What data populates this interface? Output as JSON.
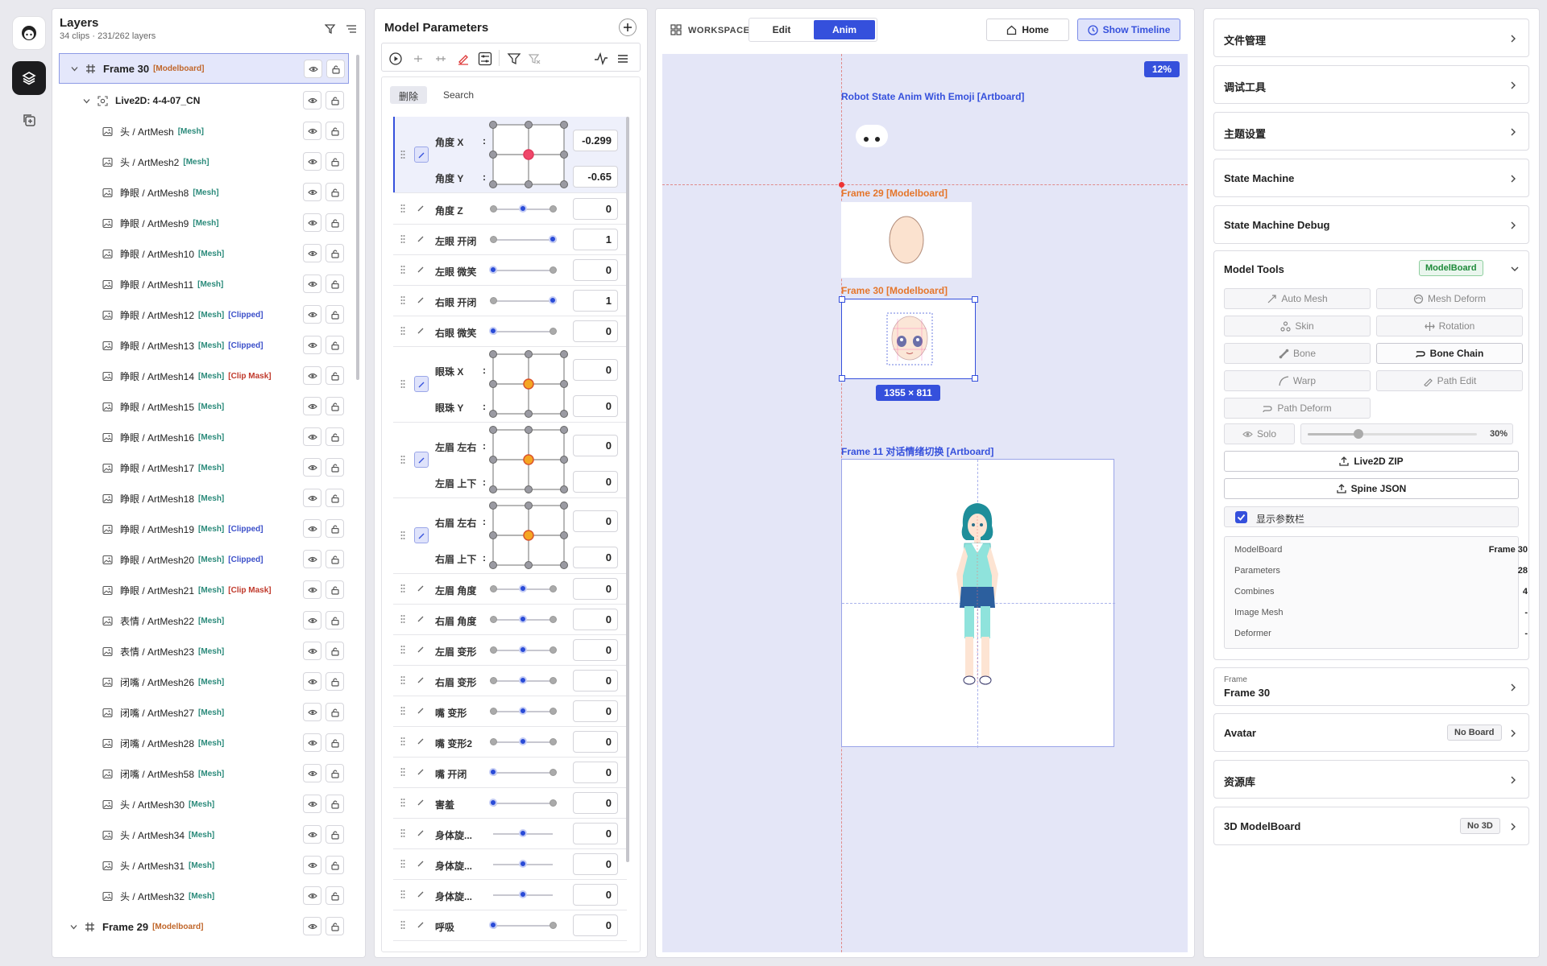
{
  "layers": {
    "title": "Layers",
    "subtitle": "34 clips · 231/262 layers",
    "rows": [
      {
        "name": "Frame 30",
        "tag": "[Modelboard]",
        "tagtype": "mb",
        "level": 0,
        "kind": "frame"
      },
      {
        "name": "Live2D: 4-4-07_CN",
        "tag": "",
        "tagtype": "",
        "level": 1,
        "kind": "live2d"
      },
      {
        "name": "头 / ArtMesh",
        "tag": "[Mesh]",
        "tagtype": "mesh",
        "level": 2,
        "kind": "mesh"
      },
      {
        "name": "头 / ArtMesh2",
        "tag": "[Mesh]",
        "tagtype": "mesh",
        "level": 2,
        "kind": "mesh"
      },
      {
        "name": "睁眼 / ArtMesh8",
        "tag": "[Mesh]",
        "tagtype": "mesh",
        "level": 2,
        "kind": "mesh"
      },
      {
        "name": "睁眼 / ArtMesh9",
        "tag": "[Mesh]",
        "tagtype": "mesh",
        "level": 2,
        "kind": "mesh"
      },
      {
        "name": "睁眼 / ArtMesh10",
        "tag": "[Mesh]",
        "tagtype": "mesh",
        "level": 2,
        "kind": "mesh"
      },
      {
        "name": "睁眼 / ArtMesh11",
        "tag": "[Mesh]",
        "tagtype": "mesh",
        "level": 2,
        "kind": "mesh"
      },
      {
        "name": "睁眼 / ArtMesh12",
        "tag": "[Mesh]",
        "tag2": "[Clipped]",
        "tagtype": "mesh",
        "tag2type": "clip",
        "level": 2,
        "kind": "mesh"
      },
      {
        "name": "睁眼 / ArtMesh13",
        "tag": "[Mesh]",
        "tag2": "[Clipped]",
        "tagtype": "mesh",
        "tag2type": "clip",
        "level": 2,
        "kind": "mesh"
      },
      {
        "name": "睁眼 / ArtMesh14",
        "tag": "[Mesh]",
        "tag2": "[Clip Mask]",
        "tagtype": "mesh",
        "tag2type": "mask",
        "level": 2,
        "kind": "mesh"
      },
      {
        "name": "睁眼 / ArtMesh15",
        "tag": "[Mesh]",
        "tagtype": "mesh",
        "level": 2,
        "kind": "mesh"
      },
      {
        "name": "睁眼 / ArtMesh16",
        "tag": "[Mesh]",
        "tagtype": "mesh",
        "level": 2,
        "kind": "mesh"
      },
      {
        "name": "睁眼 / ArtMesh17",
        "tag": "[Mesh]",
        "tagtype": "mesh",
        "level": 2,
        "kind": "mesh"
      },
      {
        "name": "睁眼 / ArtMesh18",
        "tag": "[Mesh]",
        "tagtype": "mesh",
        "level": 2,
        "kind": "mesh"
      },
      {
        "name": "睁眼 / ArtMesh19",
        "tag": "[Mesh]",
        "tag2": "[Clipped]",
        "tagtype": "mesh",
        "tag2type": "clip",
        "level": 2,
        "kind": "mesh"
      },
      {
        "name": "睁眼 / ArtMesh20",
        "tag": "[Mesh]",
        "tag2": "[Clipped]",
        "tagtype": "mesh",
        "tag2type": "clip",
        "level": 2,
        "kind": "mesh"
      },
      {
        "name": "睁眼 / ArtMesh21",
        "tag": "[Mesh]",
        "tag2": "[Clip Mask]",
        "tagtype": "mesh",
        "tag2type": "mask",
        "level": 2,
        "kind": "mesh"
      },
      {
        "name": "表情 / ArtMesh22",
        "tag": "[Mesh]",
        "tagtype": "mesh",
        "level": 2,
        "kind": "mesh"
      },
      {
        "name": "表情 / ArtMesh23",
        "tag": "[Mesh]",
        "tagtype": "mesh",
        "level": 2,
        "kind": "mesh"
      },
      {
        "name": "闭嘴 / ArtMesh26",
        "tag": "[Mesh]",
        "tagtype": "mesh",
        "level": 2,
        "kind": "mesh"
      },
      {
        "name": "闭嘴 / ArtMesh27",
        "tag": "[Mesh]",
        "tagtype": "mesh",
        "level": 2,
        "kind": "mesh"
      },
      {
        "name": "闭嘴 / ArtMesh28",
        "tag": "[Mesh]",
        "tagtype": "mesh",
        "level": 2,
        "kind": "mesh"
      },
      {
        "name": "闭嘴 / ArtMesh58",
        "tag": "[Mesh]",
        "tagtype": "mesh",
        "level": 2,
        "kind": "mesh"
      },
      {
        "name": "头 / ArtMesh30",
        "tag": "[Mesh]",
        "tagtype": "mesh",
        "level": 2,
        "kind": "mesh"
      },
      {
        "name": "头 / ArtMesh34",
        "tag": "[Mesh]",
        "tagtype": "mesh",
        "level": 2,
        "kind": "mesh"
      },
      {
        "name": "头 / ArtMesh31",
        "tag": "[Mesh]",
        "tagtype": "mesh",
        "level": 2,
        "kind": "mesh"
      },
      {
        "name": "头 / ArtMesh32",
        "tag": "[Mesh]",
        "tagtype": "mesh",
        "level": 2,
        "kind": "mesh"
      },
      {
        "name": "Frame 29",
        "tag": "[Modelboard]",
        "tagtype": "mb",
        "level": 0,
        "kind": "frame"
      }
    ]
  },
  "params": {
    "title": "Model Parameters",
    "tab_delete": "删除",
    "tab_search": "Search",
    "pads": [
      {
        "labels": [
          "角度 X",
          "角度 Y"
        ],
        "values": [
          "-0.299",
          "-0.65"
        ],
        "dot": "red"
      },
      {
        "labels": [
          "眼珠 X",
          "眼珠 Y"
        ],
        "values": [
          "0",
          "0"
        ],
        "dot": "orange"
      },
      {
        "labels": [
          "左眉 左右",
          "左眉 上下"
        ],
        "values": [
          "0",
          "0"
        ],
        "dot": "orange"
      },
      {
        "labels": [
          "右眉 左右",
          "右眉 上下"
        ],
        "values": [
          "0",
          "0"
        ],
        "dot": "orange"
      }
    ],
    "sliders_a": [
      {
        "label": "角度 Z",
        "value": "0",
        "pos": 0.5
      },
      {
        "label": "左眼 开闭",
        "value": "1",
        "pos": 1
      },
      {
        "label": "左眼 微笑",
        "value": "0",
        "pos": 0
      },
      {
        "label": "右眼 开闭",
        "value": "1",
        "pos": 1
      },
      {
        "label": "右眼 微笑",
        "value": "0",
        "pos": 0
      }
    ],
    "sliders_b": [
      {
        "label": "左眉 角度",
        "value": "0",
        "pos": 0.5
      },
      {
        "label": "右眉 角度",
        "value": "0",
        "pos": 0.5
      },
      {
        "label": "左眉 变形",
        "value": "0",
        "pos": 0.5
      },
      {
        "label": "右眉 变形",
        "value": "0",
        "pos": 0.5
      },
      {
        "label": "嘴 变形",
        "value": "0",
        "pos": 0.5
      },
      {
        "label": "嘴 变形2",
        "value": "0",
        "pos": 0.5
      },
      {
        "label": "嘴 开闭",
        "value": "0",
        "pos": 0
      },
      {
        "label": "害羞",
        "value": "0",
        "pos": 0
      },
      {
        "label": "身体旋...",
        "value": "0",
        "pos": 0.5
      },
      {
        "label": "身体旋...",
        "value": "0",
        "pos": 0.5
      },
      {
        "label": "身体旋...",
        "value": "0",
        "pos": 0.5
      },
      {
        "label": "呼吸",
        "value": "0",
        "pos": 0
      }
    ]
  },
  "workspace": {
    "label": "WORKSPACE",
    "mode_edit": "Edit",
    "mode_anim": "Anim",
    "home": "Home",
    "timeline": "Show Timeline",
    "zoom": "12%",
    "artboards": {
      "robot": "Robot State Anim With Emoji [Artboard]",
      "frame29": "Frame 29 [Modelboard]",
      "frame30": "Frame 30 [Modelboard]",
      "frame11": "Frame 11 对话情绪切换 [Artboard]"
    },
    "selection_size": "1355 × 811"
  },
  "right": {
    "cards": [
      "文件管理",
      "调试工具",
      "主题设置",
      "State Machine",
      "State Machine Debug"
    ],
    "tools": {
      "title": "Model Tools",
      "badge": "ModelBoard",
      "buttons": [
        "Auto Mesh",
        "Mesh Deform",
        "Skin",
        "Rotation",
        "Bone",
        "Bone Chain",
        "Warp",
        "Path Edit",
        "Path Deform"
      ],
      "solo": "Solo",
      "opacity": "30%",
      "opacity_frac": 0.3,
      "live2d_zip": "Live2D ZIP",
      "spine_json": "Spine JSON",
      "show_params": "显示参数栏",
      "info": [
        {
          "k": "ModelBoard",
          "v": "Frame 30"
        },
        {
          "k": "Parameters",
          "v": "28"
        },
        {
          "k": "Combines",
          "v": "4"
        },
        {
          "k": "Image Mesh",
          "v": "-"
        },
        {
          "k": "Deformer",
          "v": "-"
        }
      ]
    },
    "frame_small": "Frame",
    "frame_name": "Frame 30",
    "avatar": "Avatar",
    "avatar_badge": "No Board",
    "assets": "资源库",
    "model3d": "3D ModelBoard",
    "model3d_badge": "No 3D"
  }
}
